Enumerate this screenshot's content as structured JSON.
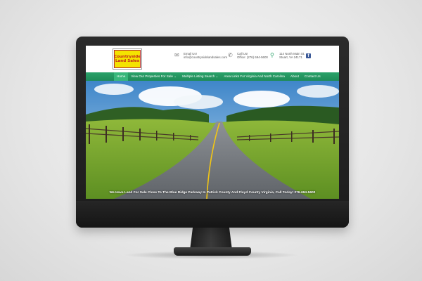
{
  "logo": {
    "line1": "Countryside",
    "line2": "Land Sales"
  },
  "header": {
    "email_label": "Email Us!",
    "email_value": "info@countrysidelandsales.com",
    "call_label": "Call Us!",
    "call_value": "Office: (276) 694-5600",
    "address_line1": "114 North Main St.",
    "address_line2": "Stuart, VA 24171",
    "facebook_icon": "facebook-icon"
  },
  "nav": {
    "items": [
      {
        "label": "Home"
      },
      {
        "label": "View Our Properties For Sale ⌄"
      },
      {
        "label": "Multiple Listing Search ⌄"
      },
      {
        "label": "Area Links For Virginia And North Carolina"
      },
      {
        "label": "About"
      },
      {
        "label": "Contact Us"
      }
    ]
  },
  "hero": {
    "tagline": "We Have Land For Sale Close To The Blue Ridge Parkway In Patrick County And Floyd County Virginia, Call Today! 276-694-5600"
  },
  "colors": {
    "nav_green": "#1f8b58",
    "logo_yellow": "#f4e300",
    "logo_red": "#c0231b",
    "facebook": "#3b5998"
  }
}
